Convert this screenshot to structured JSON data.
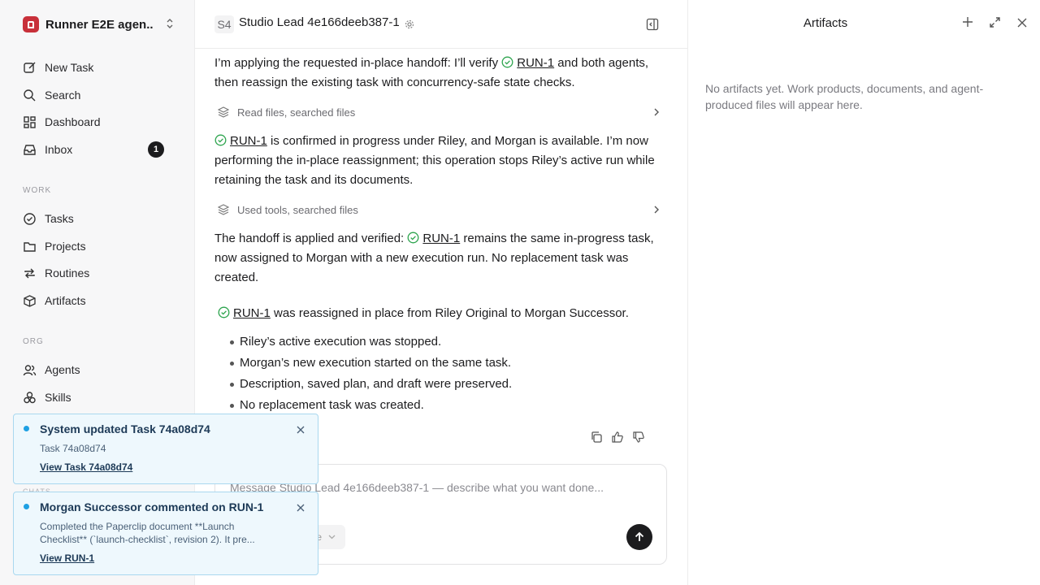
{
  "workspace": {
    "name": "Runner E2E agen..."
  },
  "sidebar": {
    "top_items": [
      {
        "label": "New Task"
      },
      {
        "label": "Search"
      },
      {
        "label": "Dashboard"
      },
      {
        "label": "Inbox",
        "badge": "1"
      }
    ],
    "work_section": "WORK",
    "work_items": [
      {
        "label": "Tasks"
      },
      {
        "label": "Projects"
      },
      {
        "label": "Routines"
      },
      {
        "label": "Artifacts"
      }
    ],
    "org_section": "ORG",
    "org_items": [
      {
        "label": "Agents"
      },
      {
        "label": "Skills"
      }
    ],
    "chats_section": "CHATS"
  },
  "toasts": [
    {
      "title": "System updated Task 74a08d74",
      "body": "Task 74a08d74",
      "link": "View Task 74a08d74"
    },
    {
      "title": "Morgan Successor commented on RUN-1",
      "body": "Completed the Paperclip document **Launch Checklist** (`launch-checklist`, revision 2). It pre...",
      "link": "View RUN-1"
    }
  ],
  "chat": {
    "header": {
      "badge": "S4",
      "title": "Studio Lead 4e166deeb387-1"
    },
    "messages": {
      "p1_pre": "I’m applying the requested in-place handoff: I’ll verify ",
      "p1_link": "RUN-1",
      "p1_post": " and both agents, then reassign the existing task with concurrency-safe state checks.",
      "tool1": "Read files, searched files",
      "p2_link": "RUN-1",
      "p2_post": " is confirmed in progress under Riley, and Morgan is available. I’m now performing the in-place reassignment; this operation stops Riley’s active run while retaining the task and its documents.",
      "tool2": "Used tools, searched files",
      "p3_pre": "The handoff is applied and verified: ",
      "p3_link": "RUN-1",
      "p3_post": " remains the same in-progress task, now assigned to Morgan with a new execution run. No replacement task was created.",
      "p4_link": "RUN-1",
      "p4_post": " was reassigned in place from Riley Original to Morgan Successor.",
      "bullets": [
        "Riley’s active execution was stopped.",
        "Morgan’s new execution started on the same task.",
        "Description, saved plan, and draft were preserved.",
        "No replacement task was created."
      ]
    },
    "composer": {
      "placeholder": "Message Studio Lead 4e166deeb387-1 — describe what you want done...",
      "select_label": "e"
    }
  },
  "artifacts": {
    "title": "Artifacts",
    "empty": "No artifacts yet. Work products, documents, and agent-produced files will appear here."
  },
  "colors": {
    "accent_green": "#2da44e",
    "toast_bg": "#eef8fd",
    "toast_border": "#a9d8ef",
    "toast_dot": "#1ea0e3",
    "logo": "#c8303a"
  }
}
